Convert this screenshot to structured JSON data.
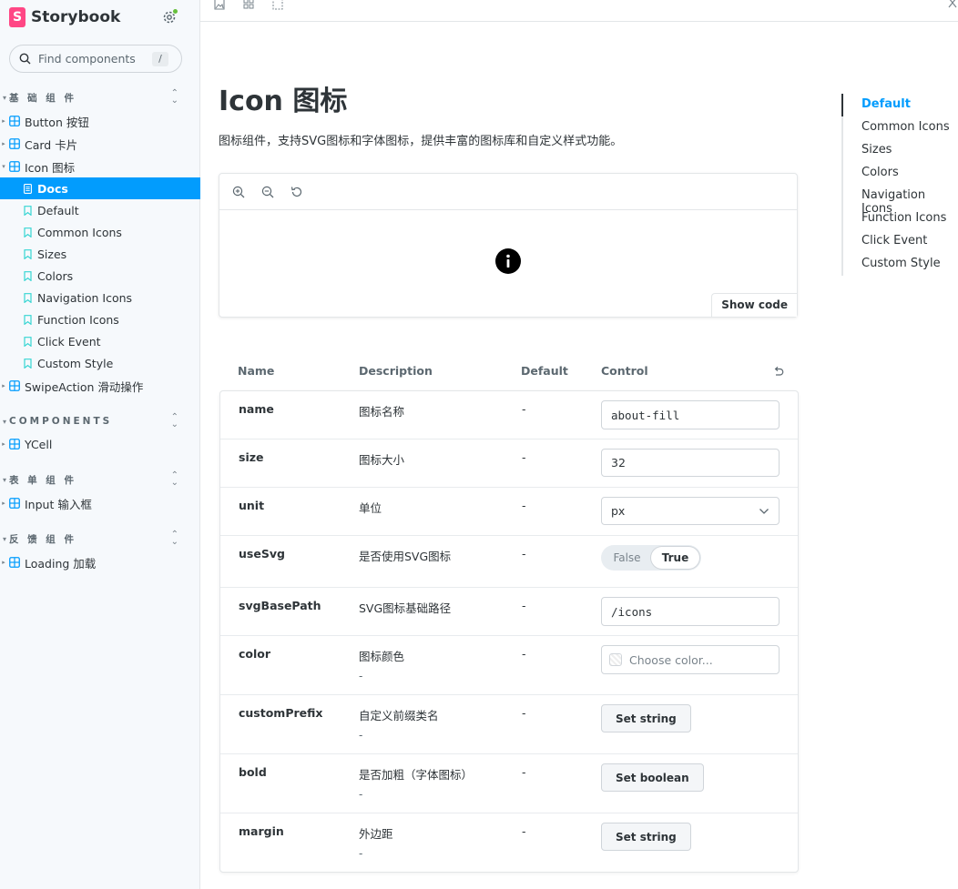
{
  "brand": {
    "name": "Storybook",
    "logo_letter": "S"
  },
  "search": {
    "placeholder": "Find components",
    "shortcut": "/"
  },
  "sidebar": {
    "sections": [
      {
        "title": "基 础 组 件"
      },
      {
        "title": "COMPONENTS"
      },
      {
        "title": "表 单 组 件"
      },
      {
        "title": "反 馈 组 件"
      }
    ],
    "components": [
      {
        "label": "Button 按钮"
      },
      {
        "label": "Card 卡片"
      },
      {
        "label": "Icon 图标"
      },
      {
        "label": "SwipeAction 滑动操作"
      },
      {
        "label": "YCell"
      },
      {
        "label": "Input 输入框"
      },
      {
        "label": "Loading 加载"
      }
    ],
    "stories": [
      {
        "label": "Docs"
      },
      {
        "label": "Default"
      },
      {
        "label": "Common Icons"
      },
      {
        "label": "Sizes"
      },
      {
        "label": "Colors"
      },
      {
        "label": "Navigation Icons"
      },
      {
        "label": "Function Icons"
      },
      {
        "label": "Click Event"
      },
      {
        "label": "Custom Style"
      }
    ]
  },
  "doc": {
    "title": "Icon 图标",
    "description": "图标组件，支持SVG图标和字体图标，提供丰富的图标库和自定义样式功能。",
    "show_code": "Show code"
  },
  "args_table": {
    "headers": {
      "name": "Name",
      "description": "Description",
      "default": "Default",
      "control": "Control"
    },
    "rows": [
      {
        "name": "name",
        "description": "图标名称",
        "default": "-",
        "value": "about-fill"
      },
      {
        "name": "size",
        "description": "图标大小",
        "default": "-",
        "value": "32"
      },
      {
        "name": "unit",
        "description": "单位",
        "default": "-",
        "value": "px"
      },
      {
        "name": "useSvg",
        "description": "是否使用SVG图标",
        "default": "-",
        "off": "False",
        "on": "True"
      },
      {
        "name": "svgBasePath",
        "description": "SVG图标基础路径",
        "default": "-",
        "value": "/icons"
      },
      {
        "name": "color",
        "description": "图标颜色",
        "sub": "-",
        "default": "-",
        "placeholder": "Choose color..."
      },
      {
        "name": "customPrefix",
        "description": "自定义前缀类名",
        "sub": "-",
        "default": "-",
        "button": "Set string"
      },
      {
        "name": "bold",
        "description": "是否加粗（字体图标）",
        "sub": "-",
        "default": "-",
        "button": "Set boolean"
      },
      {
        "name": "margin",
        "description": "外边距",
        "sub": "-",
        "default": "-",
        "button": "Set string"
      }
    ]
  },
  "toc": [
    "Default",
    "Common Icons",
    "Sizes",
    "Colors",
    "Navigation Icons",
    "Function Icons",
    "Click Event",
    "Custom Style"
  ],
  "colors": {
    "accent": "#029cfd",
    "brand": "#ff4785",
    "status": "#66bf3c"
  }
}
